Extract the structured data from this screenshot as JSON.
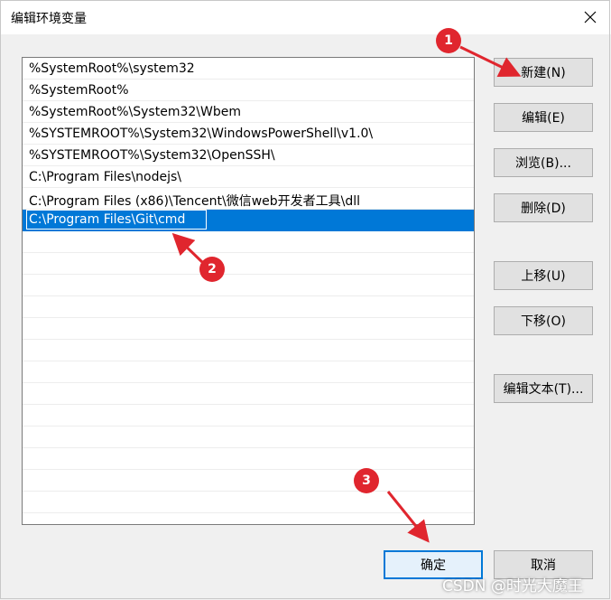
{
  "window": {
    "title": "编辑环境变量"
  },
  "paths": [
    "%SystemRoot%\\system32",
    "%SystemRoot%",
    "%SystemRoot%\\System32\\Wbem",
    "%SYSTEMROOT%\\System32\\WindowsPowerShell\\v1.0\\",
    "%SYSTEMROOT%\\System32\\OpenSSH\\",
    "C:\\Program Files\\nodejs\\",
    "C:\\Program Files (x86)\\Tencent\\微信web开发者工具\\dll"
  ],
  "editing_value": "C:\\Program Files\\Git\\cmd",
  "buttons": {
    "new": "新建(N)",
    "edit": "编辑(E)",
    "browse": "浏览(B)...",
    "delete": "删除(D)",
    "move_up": "上移(U)",
    "move_down": "下移(O)",
    "edit_text": "编辑文本(T)...",
    "ok": "确定",
    "cancel": "取消"
  },
  "annotations": [
    "1",
    "2",
    "3"
  ],
  "watermark": "CSDN @时光大魔王",
  "colors": {
    "selection": "#0078d7",
    "marker": "#e0262e"
  }
}
